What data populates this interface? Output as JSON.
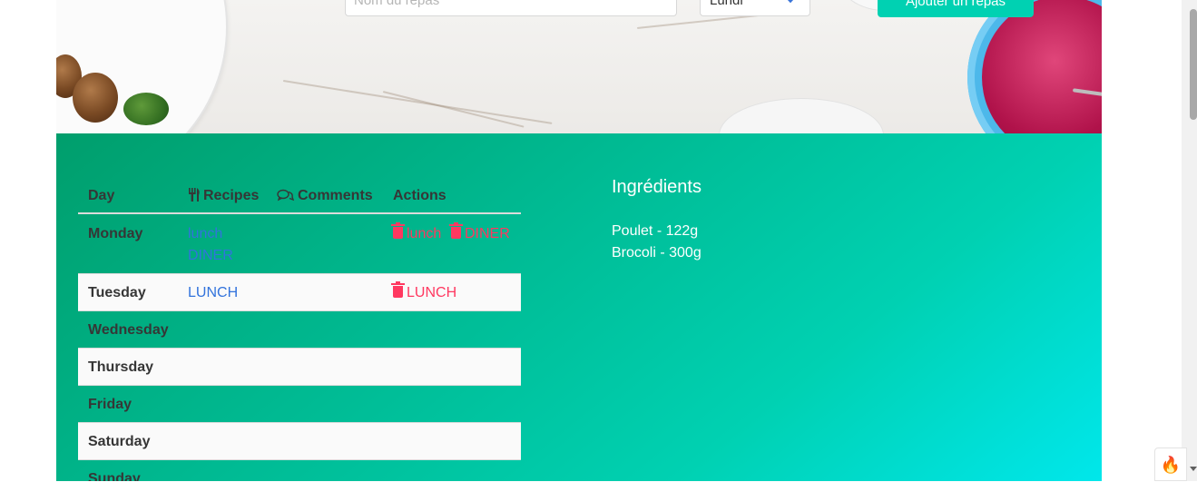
{
  "form": {
    "meal_name_placeholder": "Nom du repas",
    "day_select_value": "Lundi",
    "add_button_label": "Ajouter un repas"
  },
  "table": {
    "headers": {
      "day": "Day",
      "recipes": "Recipes",
      "comments": "Comments",
      "actions": "Actions",
      "recipes_icon": "cutlery-icon",
      "comments_icon": "comments-icon"
    },
    "rows": [
      {
        "day": "Monday",
        "recipes": [
          "lunch",
          "DINER"
        ],
        "actions": [
          "lunch",
          "DINER"
        ]
      },
      {
        "day": "Tuesday",
        "recipes": [
          "LUNCH"
        ],
        "actions": [
          "LUNCH"
        ]
      },
      {
        "day": "Wednesday",
        "recipes": [],
        "actions": []
      },
      {
        "day": "Thursday",
        "recipes": [],
        "actions": []
      },
      {
        "day": "Friday",
        "recipes": [],
        "actions": []
      },
      {
        "day": "Saturday",
        "recipes": [],
        "actions": []
      },
      {
        "day": "Sunday",
        "recipes": [],
        "actions": []
      }
    ]
  },
  "ingredients": {
    "title": "Ingrédients",
    "items": [
      "Poulet - 122g",
      "Brocoli - 300g"
    ]
  },
  "colors": {
    "primary": "#00d1b2",
    "link": "#3273dc",
    "danger": "#ff3860",
    "gradient_start": "#009e6c",
    "gradient_end": "#00e7eb"
  },
  "icons": {
    "delete": "trash-icon",
    "extension": "flame-icon"
  }
}
